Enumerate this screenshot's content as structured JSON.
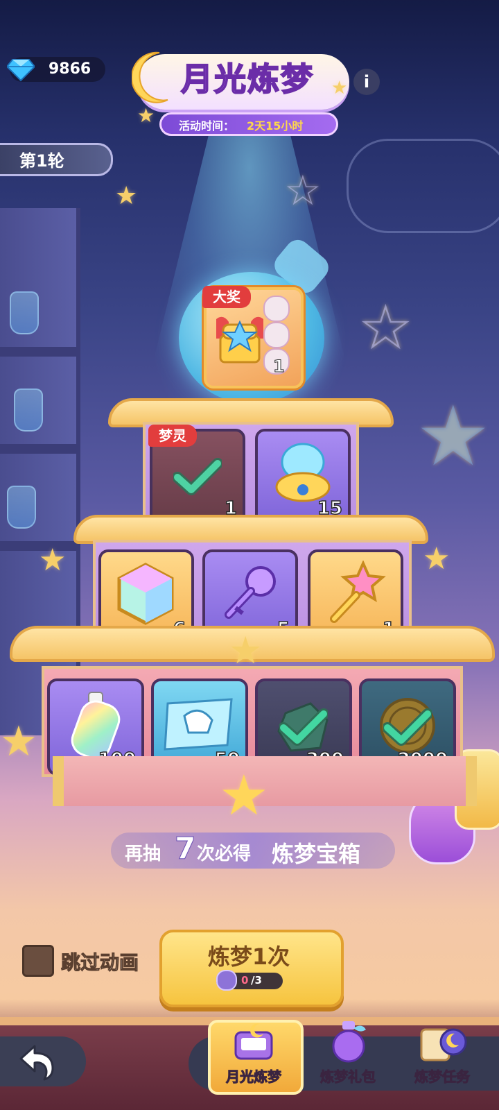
{
  "header": {
    "gem_count": "9866",
    "title": "月光炼梦",
    "event_time_label": "活动时间：",
    "event_time_value": "2天15小时",
    "round_label": "第1轮"
  },
  "grand_prize": {
    "tag": "大奖",
    "count": "1"
  },
  "tier1": [
    {
      "tag": "梦灵",
      "count": "1",
      "claimed": true,
      "icon": "dream-spirit-icon"
    },
    {
      "count": "15",
      "claimed": false,
      "icon": "blue-spirit-capsule-icon"
    }
  ],
  "tier2": [
    {
      "count": "6",
      "claimed": false,
      "icon": "rainbow-crystal-cube-icon"
    },
    {
      "count": "5",
      "claimed": false,
      "icon": "purple-key-icon"
    },
    {
      "count": "1",
      "claimed": false,
      "icon": "star-key-icon"
    }
  ],
  "tier3": [
    {
      "count": "100",
      "claimed": false,
      "icon": "rainbow-bottle-icon"
    },
    {
      "count": "50",
      "claimed": false,
      "icon": "map-scroll-icon"
    },
    {
      "count": "300",
      "claimed": true,
      "icon": "ore-stone-icon"
    },
    {
      "count": "2000",
      "claimed": true,
      "icon": "gold-coin-icon"
    }
  ],
  "pity": {
    "prefix": "再抽",
    "number": "7",
    "middle": "次必得",
    "reward": "炼梦宝箱"
  },
  "controls": {
    "skip_label": "跳过动画",
    "draw_label": "炼梦1次",
    "draw_cost_have": "0",
    "draw_cost_need": "/3"
  },
  "nav": {
    "tabs": [
      "月光炼梦",
      "炼梦礼包",
      "炼梦任务"
    ]
  },
  "colors": {
    "accent_purple": "#b36af0",
    "gold": "#f6c43f",
    "claimed_check": "#43d6a1"
  }
}
